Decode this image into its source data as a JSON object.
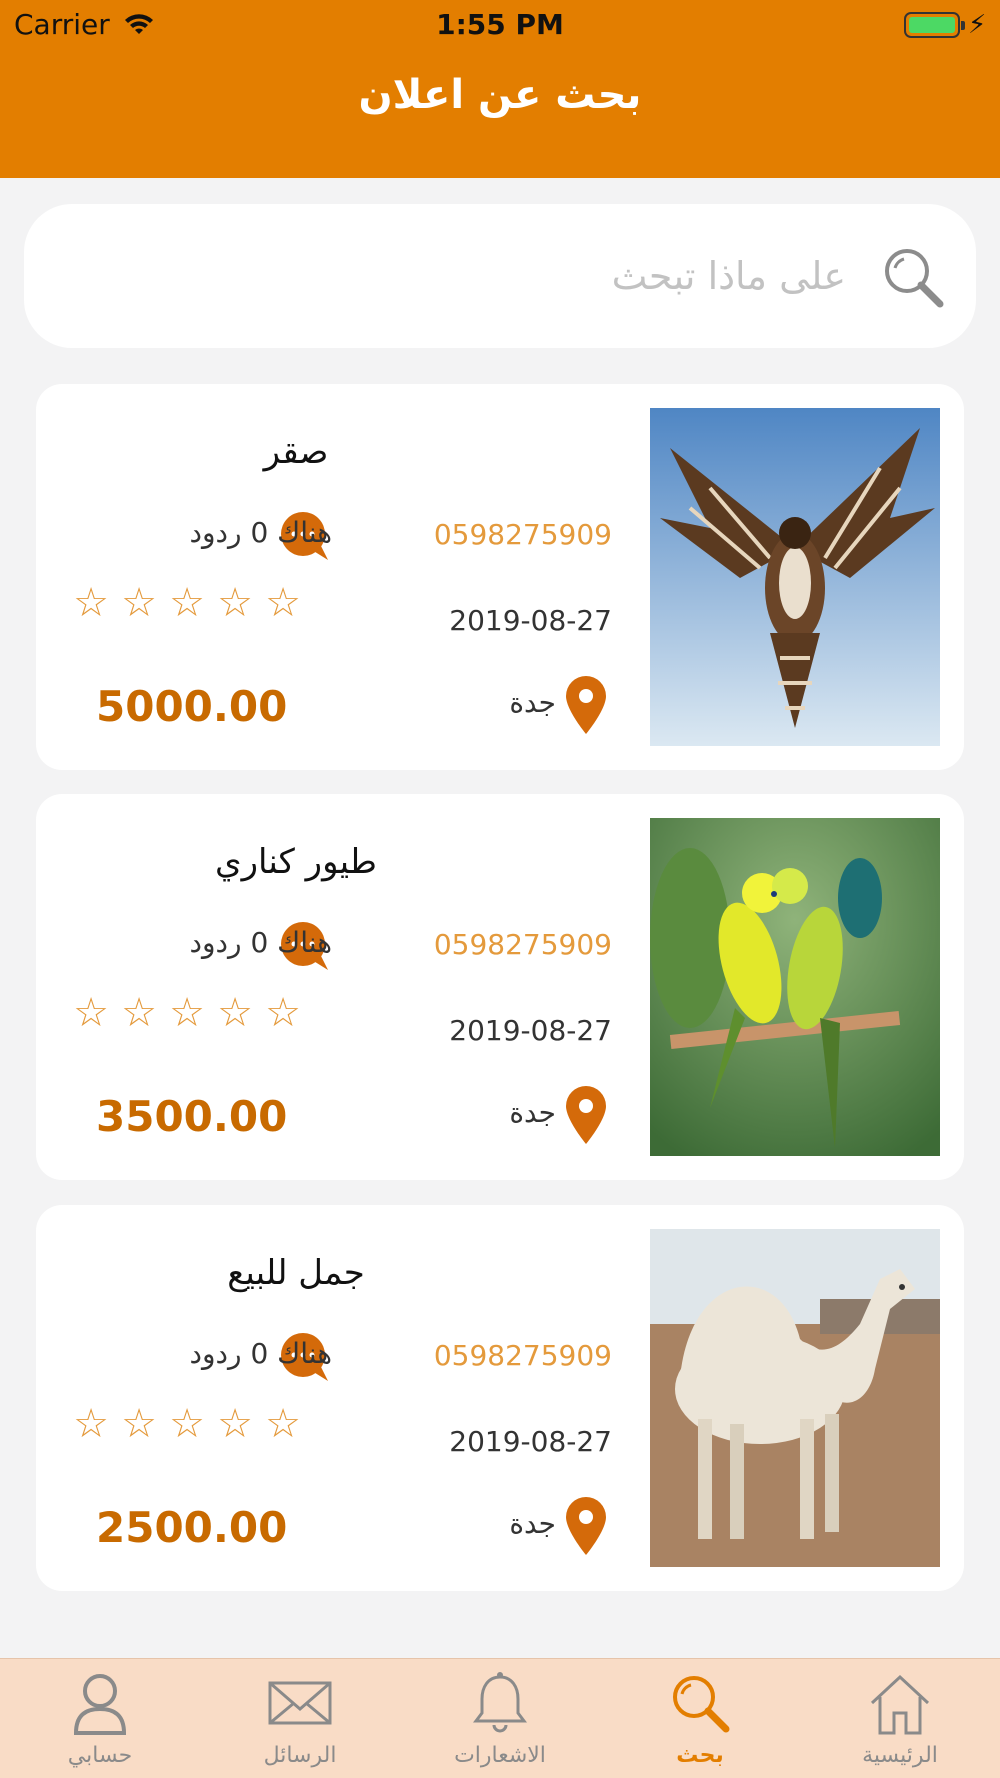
{
  "status_bar": {
    "carrier": "Carrier",
    "time": "1:55 PM"
  },
  "header": {
    "title": "بحث عن اعلان"
  },
  "search": {
    "placeholder": "على ماذا تبحث",
    "value": ""
  },
  "listings": [
    {
      "name": "صقر",
      "phone": "0598275909",
      "replies": "هناك 0 ردود",
      "date": "2019-08-27",
      "city": "جدة",
      "price": "5000.00",
      "rating": 0,
      "image": "falcon"
    },
    {
      "name": "طيور كناري",
      "phone": "0598275909",
      "replies": "هناك 0 ردود",
      "date": "2019-08-27",
      "city": "جدة",
      "price": "3500.00",
      "rating": 0,
      "image": "parakeets"
    },
    {
      "name": "جمل للبيع",
      "phone": "0598275909",
      "replies": "هناك 0 ردود",
      "date": "2019-08-27",
      "city": "جدة",
      "price": "2500.00",
      "rating": 0,
      "image": "camel"
    }
  ],
  "rating_symbol": "☆",
  "tabbar": {
    "items": [
      {
        "label": "حسابي",
        "icon": "person-icon",
        "active": false
      },
      {
        "label": "الرسائل",
        "icon": "envelope-icon",
        "active": false
      },
      {
        "label": "الاشعارات",
        "icon": "bell-icon",
        "active": false
      },
      {
        "label": "بحث",
        "icon": "search-icon",
        "active": true
      },
      {
        "label": "الرئيسية",
        "icon": "home-icon",
        "active": false
      }
    ]
  },
  "colors": {
    "accent": "#e37e00",
    "price": "#c86a00",
    "phone": "#e49a3c",
    "tabbar_bg": "#f9dcc6"
  }
}
